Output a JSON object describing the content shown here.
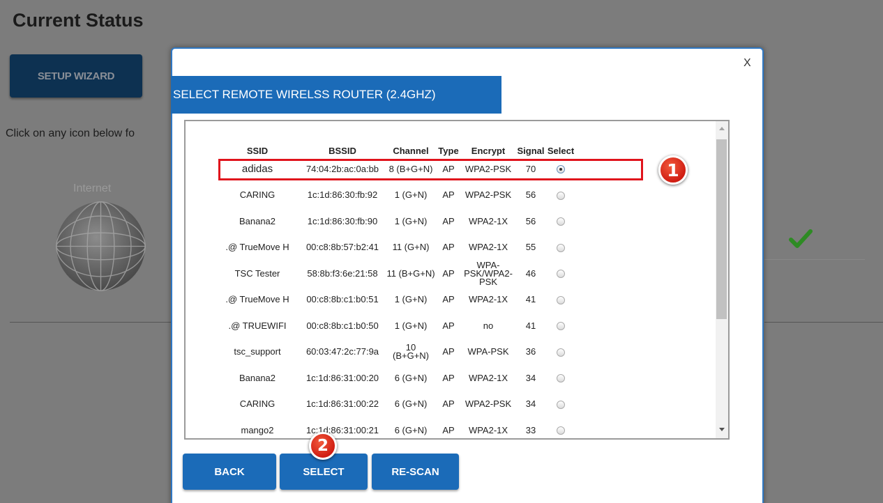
{
  "background": {
    "title": "Current Status",
    "setup_wizard_label": "SETUP WIZARD",
    "hint_text": "Click on any icon below fo",
    "internet_label": "Internet"
  },
  "modal": {
    "close_label": "X",
    "title": "SELECT REMOTE WIRELSS ROUTER (2.4GHZ)",
    "columns": [
      "SSID",
      "BSSID",
      "Channel",
      "Type",
      "Encrypt",
      "Signal",
      "Select"
    ],
    "rows": [
      {
        "ssid": "adidas",
        "bssid": "74:04:2b:ac:0a:bb",
        "channel": "8 (B+G+N)",
        "type": "AP",
        "encrypt": "WPA2-PSK",
        "signal": "70",
        "selected": true
      },
      {
        "ssid": "CARING",
        "bssid": "1c:1d:86:30:fb:92",
        "channel": "1 (G+N)",
        "type": "AP",
        "encrypt": "WPA2-PSK",
        "signal": "56",
        "selected": false
      },
      {
        "ssid": "Banana2",
        "bssid": "1c:1d:86:30:fb:90",
        "channel": "1 (G+N)",
        "type": "AP",
        "encrypt": "WPA2-1X",
        "signal": "56",
        "selected": false
      },
      {
        "ssid": ".@ TrueMove H",
        "bssid": "00:c8:8b:57:b2:41",
        "channel": "11 (G+N)",
        "type": "AP",
        "encrypt": "WPA2-1X",
        "signal": "55",
        "selected": false
      },
      {
        "ssid": "TSC Tester",
        "bssid": "58:8b:f3:6e:21:58",
        "channel": "11 (B+G+N)",
        "type": "AP",
        "encrypt": "WPA-PSK/WPA2-PSK",
        "signal": "46",
        "selected": false
      },
      {
        "ssid": ".@ TrueMove H",
        "bssid": "00:c8:8b:c1:b0:51",
        "channel": "1 (G+N)",
        "type": "AP",
        "encrypt": "WPA2-1X",
        "signal": "41",
        "selected": false
      },
      {
        "ssid": ".@ TRUEWIFI",
        "bssid": "00:c8:8b:c1:b0:50",
        "channel": "1 (G+N)",
        "type": "AP",
        "encrypt": "no",
        "signal": "41",
        "selected": false
      },
      {
        "ssid": "tsc_support",
        "bssid": "60:03:47:2c:77:9a",
        "channel": "10 (B+G+N)",
        "type": "AP",
        "encrypt": "WPA-PSK",
        "signal": "36",
        "selected": false
      },
      {
        "ssid": "Banana2",
        "bssid": "1c:1d:86:31:00:20",
        "channel": "6 (G+N)",
        "type": "AP",
        "encrypt": "WPA2-1X",
        "signal": "34",
        "selected": false
      },
      {
        "ssid": "CARING",
        "bssid": "1c:1d:86:31:00:22",
        "channel": "6 (G+N)",
        "type": "AP",
        "encrypt": "WPA2-PSK",
        "signal": "34",
        "selected": false
      },
      {
        "ssid": "mango2",
        "bssid": "1c:1d:86:31:00:21",
        "channel": "6 (G+N)",
        "type": "AP",
        "encrypt": "WPA2-1X",
        "signal": "33",
        "selected": false
      }
    ],
    "buttons": {
      "back": "BACK",
      "select": "SELECT",
      "rescan": "RE-SCAN"
    }
  },
  "annotations": {
    "badge_1": "1",
    "badge_2": "2",
    "highlight_color": "#e0141c"
  },
  "colors": {
    "accent": "#1b6bb8",
    "wizard": "#0d3151",
    "success": "#2e8b24"
  }
}
